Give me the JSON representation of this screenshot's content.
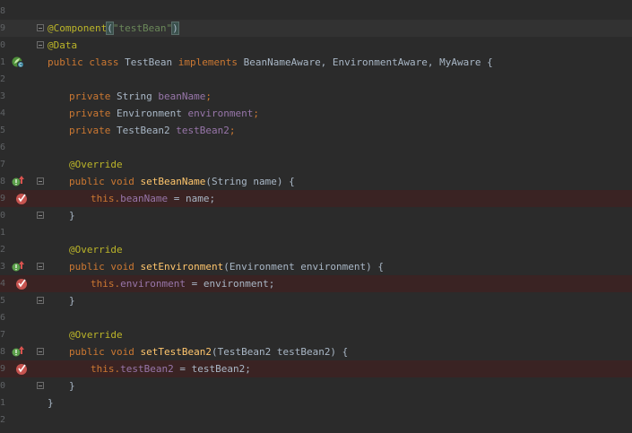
{
  "line_numbers": [
    "8",
    "9",
    "0",
    "1",
    "2",
    "3",
    "4",
    "5",
    "6",
    "7",
    "8",
    "9",
    "0",
    "1",
    "2",
    "3",
    "4",
    "5",
    "6",
    "7",
    "8",
    "9",
    "0",
    "1",
    "2"
  ],
  "code": {
    "annotation_component": "@Component",
    "component_value": "\"testBean\"",
    "annotation_data": "@Data",
    "kw_public": "public",
    "kw_class": "class",
    "class_name": "TestBean",
    "kw_implements": "implements",
    "interfaces": "BeanNameAware, EnvironmentAware, MyAware {",
    "kw_private": "private",
    "type_string": "String",
    "type_environment": "Environment",
    "type_testbean2": "TestBean2",
    "field_beanName": "beanName",
    "field_environment": "environment",
    "field_testBean2": "testBean2",
    "semicolon": ";",
    "override": "@Override",
    "kw_void": "void",
    "method_setBeanName": "setBeanName",
    "params_setBeanName": "(String name) {",
    "kw_this": "this.",
    "assign_name": " = name;",
    "close_brace": "}",
    "method_setEnvironment": "setEnvironment",
    "params_setEnvironment": "(Environment environment) {",
    "assign_environment": " = environment;",
    "method_setTestBean2": "setTestBean2",
    "params_setTestBean2": "(TestBean2 testBean2) {",
    "assign_testBean2": " = testBean2;"
  },
  "icons": {
    "class_gutter": "spring-bean-icon",
    "implements_marker": "implements-method-icon",
    "breakpoint": "breakpoint-icon"
  },
  "colors": {
    "background": "#2b2b2b",
    "keyword": "#cc7832",
    "annotation": "#bbb529",
    "string": "#6a8759",
    "field": "#9876aa",
    "method": "#ffc66d",
    "text": "#a9b7c6",
    "breakpoint_line": "#3a2323"
  }
}
